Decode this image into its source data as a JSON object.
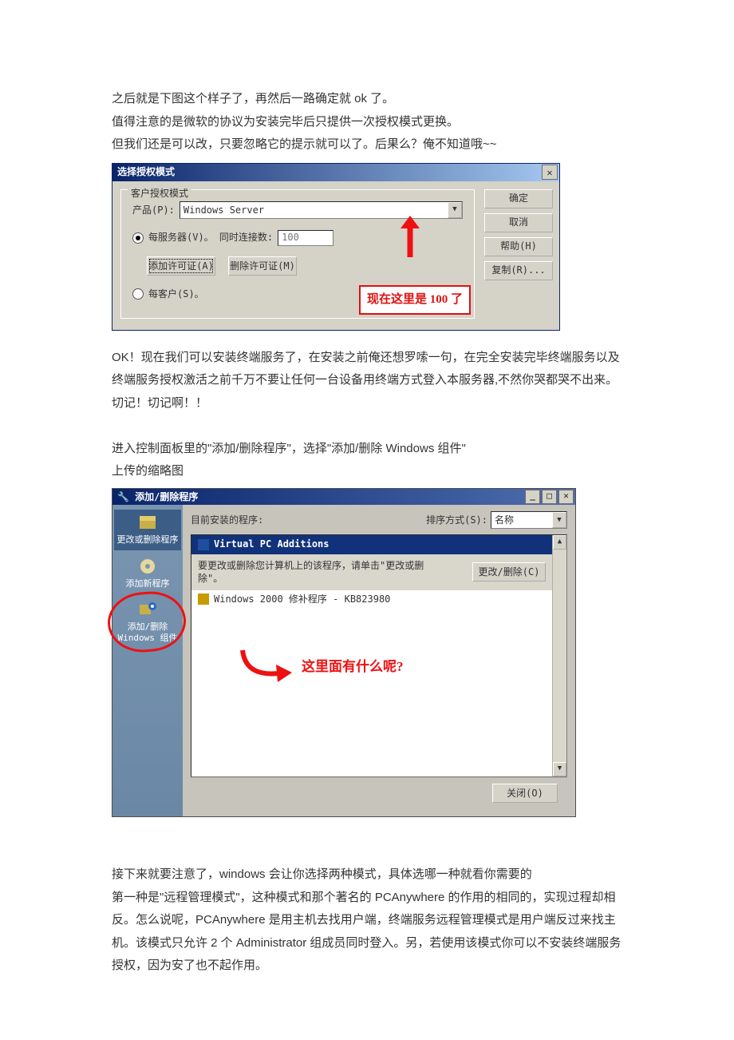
{
  "para": {
    "p1": "之后就是下图这个样子了，再然后一路确定就 ok 了。",
    "p2": "值得注意的是微软的协议为安装完毕后只提供一次授权模式更换。",
    "p3": "但我们还是可以改，只要忽略它的提示就可以了。后果么？俺不知道哦~~",
    "p4": "OK！现在我们可以安装终端服务了，在安装之前俺还想罗嗦一句，在完全安装完毕终端服务以及终端服务授权激活之前千万不要让任何一台设备用终端方式登入本服务器,不然你哭都哭不出来。",
    "p5": "切记！切记啊！！",
    "p6": "进入控制面板里的\"添加/删除程序\"，选择\"添加/删除 Windows 组件\"",
    "p7": "上传的缩略图",
    "p8": "接下来就要注意了，windows 会让你选择两种模式，具体选哪一种就看你需要的",
    "p9": "第一种是\"远程管理模式\"，这种模式和那个著名的 PCAnywhere 的作用的相同的，实现过程却相反。怎么说呢，PCAnywhere 是用主机去找用户端，终端服务远程管理模式是用户端反过来找主机。该模式只允许 2 个 Administrator 组成员同时登入。另，若使用该模式你可以不安装终端服务授权，因为安了也不起作用。"
  },
  "dlg1": {
    "title": "选择授权模式",
    "group": "客户授权模式",
    "product_label": "产品(P):",
    "product_value": "Windows Server",
    "per_server": "每服务器(V)。  同时连接数:",
    "conn_value": "100",
    "per_client": "每客户(S)。",
    "add_license": "添加许可证(A)",
    "del_license": "删除许可证(M)",
    "ok": "确定",
    "cancel": "取消",
    "help": "帮助(H)",
    "copy": "复制(R)...",
    "callout": "现在这里是 100 了"
  },
  "dlg2": {
    "title": "添加/删除程序",
    "sidebar": {
      "change": "更改或删除程序",
      "add": "添加新程序",
      "comp": "添加/删除\nWindows 组件"
    },
    "installed_label": "目前安装的程序:",
    "sort_label": "排序方式(S):",
    "sort_value": "名称",
    "items": {
      "vpc": "Virtual PC Additions",
      "desc": "要更改或删除您计算机上的该程序，请单击\"更改或删除\"。",
      "changebtn": "更改/删除(C)",
      "kb": "Windows 2000 修补程序 - KB823980"
    },
    "annotation": "这里面有什么呢?",
    "close": "关闭(O)"
  }
}
